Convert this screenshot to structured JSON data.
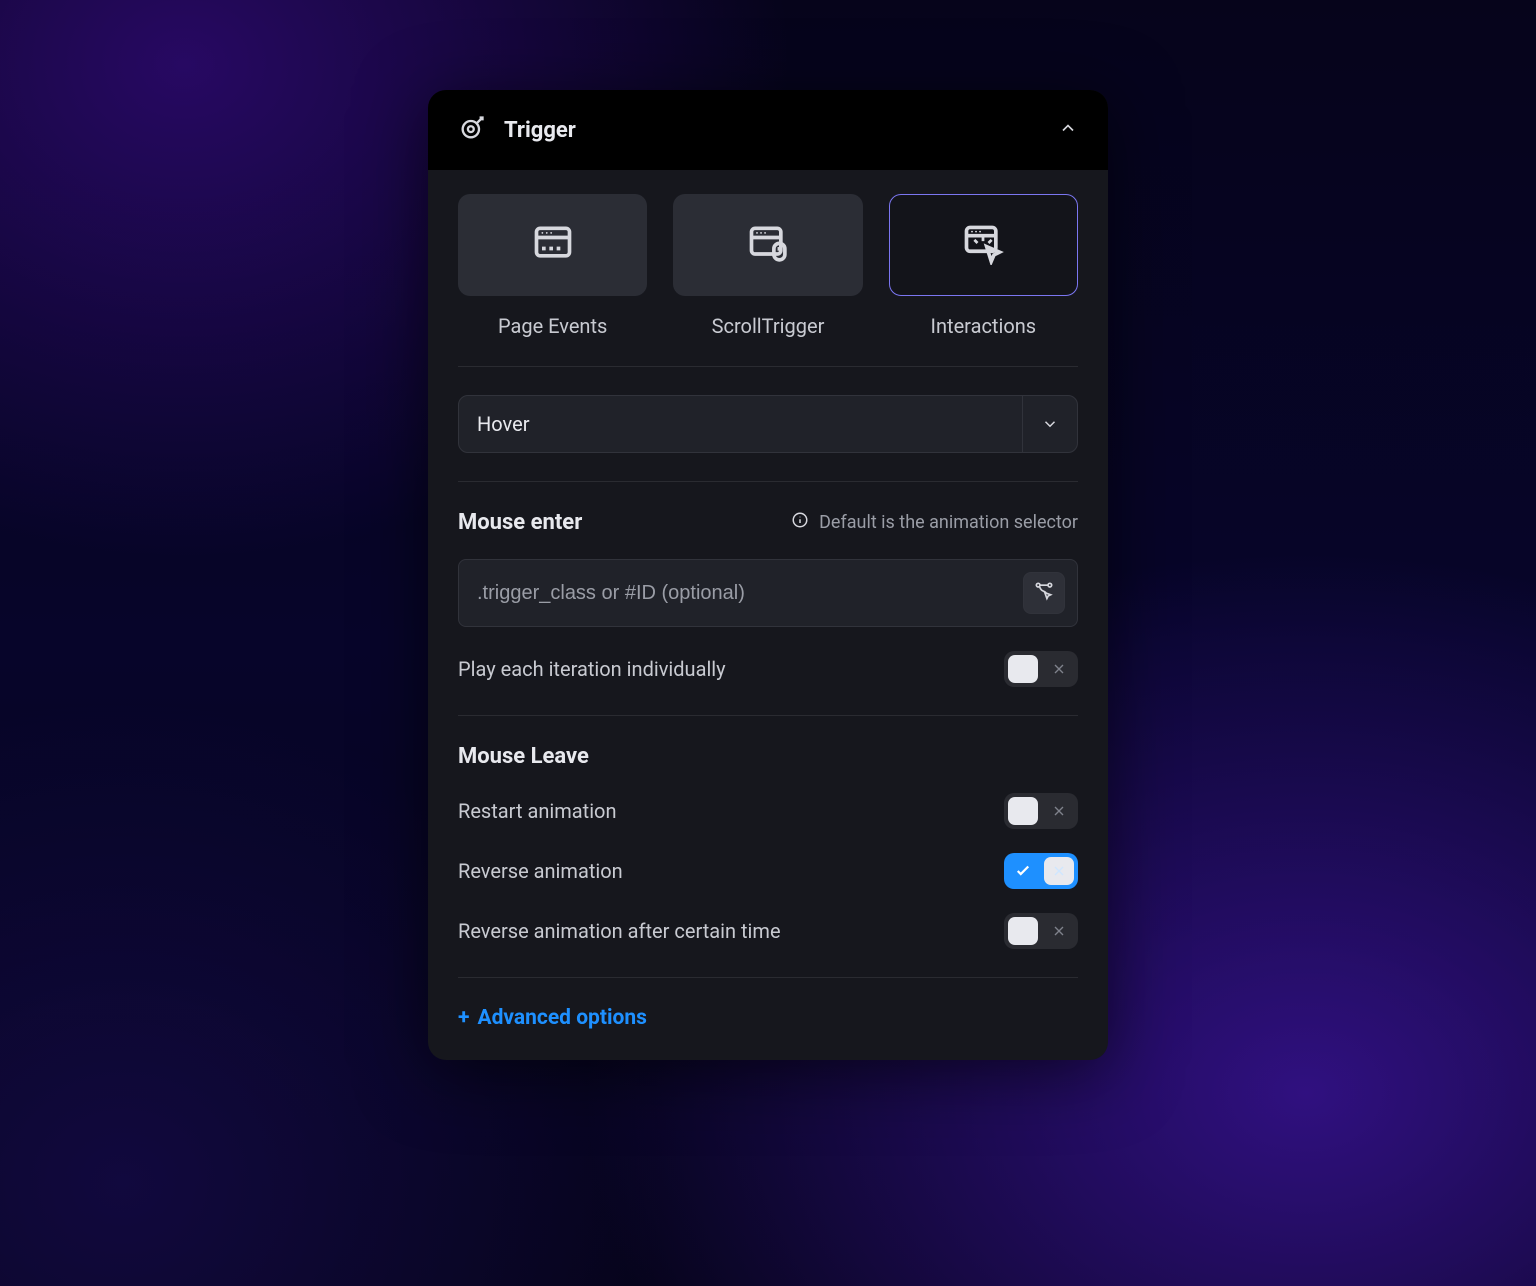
{
  "panel": {
    "title": "Trigger",
    "collapsed": false
  },
  "tabs": [
    {
      "id": "page-events",
      "label": "Page Events",
      "selected": false
    },
    {
      "id": "scroll-trigger",
      "label": "ScrollTrigger",
      "selected": false
    },
    {
      "id": "interactions",
      "label": "Interactions",
      "selected": true
    }
  ],
  "interaction_select": {
    "value": "Hover"
  },
  "mouse_enter": {
    "heading": "Mouse enter",
    "hint": "Default is the animation selector",
    "selector_placeholder": ".trigger_class or #ID (optional)",
    "selector_value": "",
    "options": {
      "play_each_iteration": {
        "label": "Play each iteration individually",
        "value": false
      }
    }
  },
  "mouse_leave": {
    "heading": "Mouse Leave",
    "options": {
      "restart_animation": {
        "label": "Restart animation",
        "value": false
      },
      "reverse_animation": {
        "label": "Reverse animation",
        "value": true
      },
      "reverse_after_time": {
        "label": "Reverse animation after certain time",
        "value": false
      }
    }
  },
  "advanced": {
    "label": "Advanced options"
  }
}
